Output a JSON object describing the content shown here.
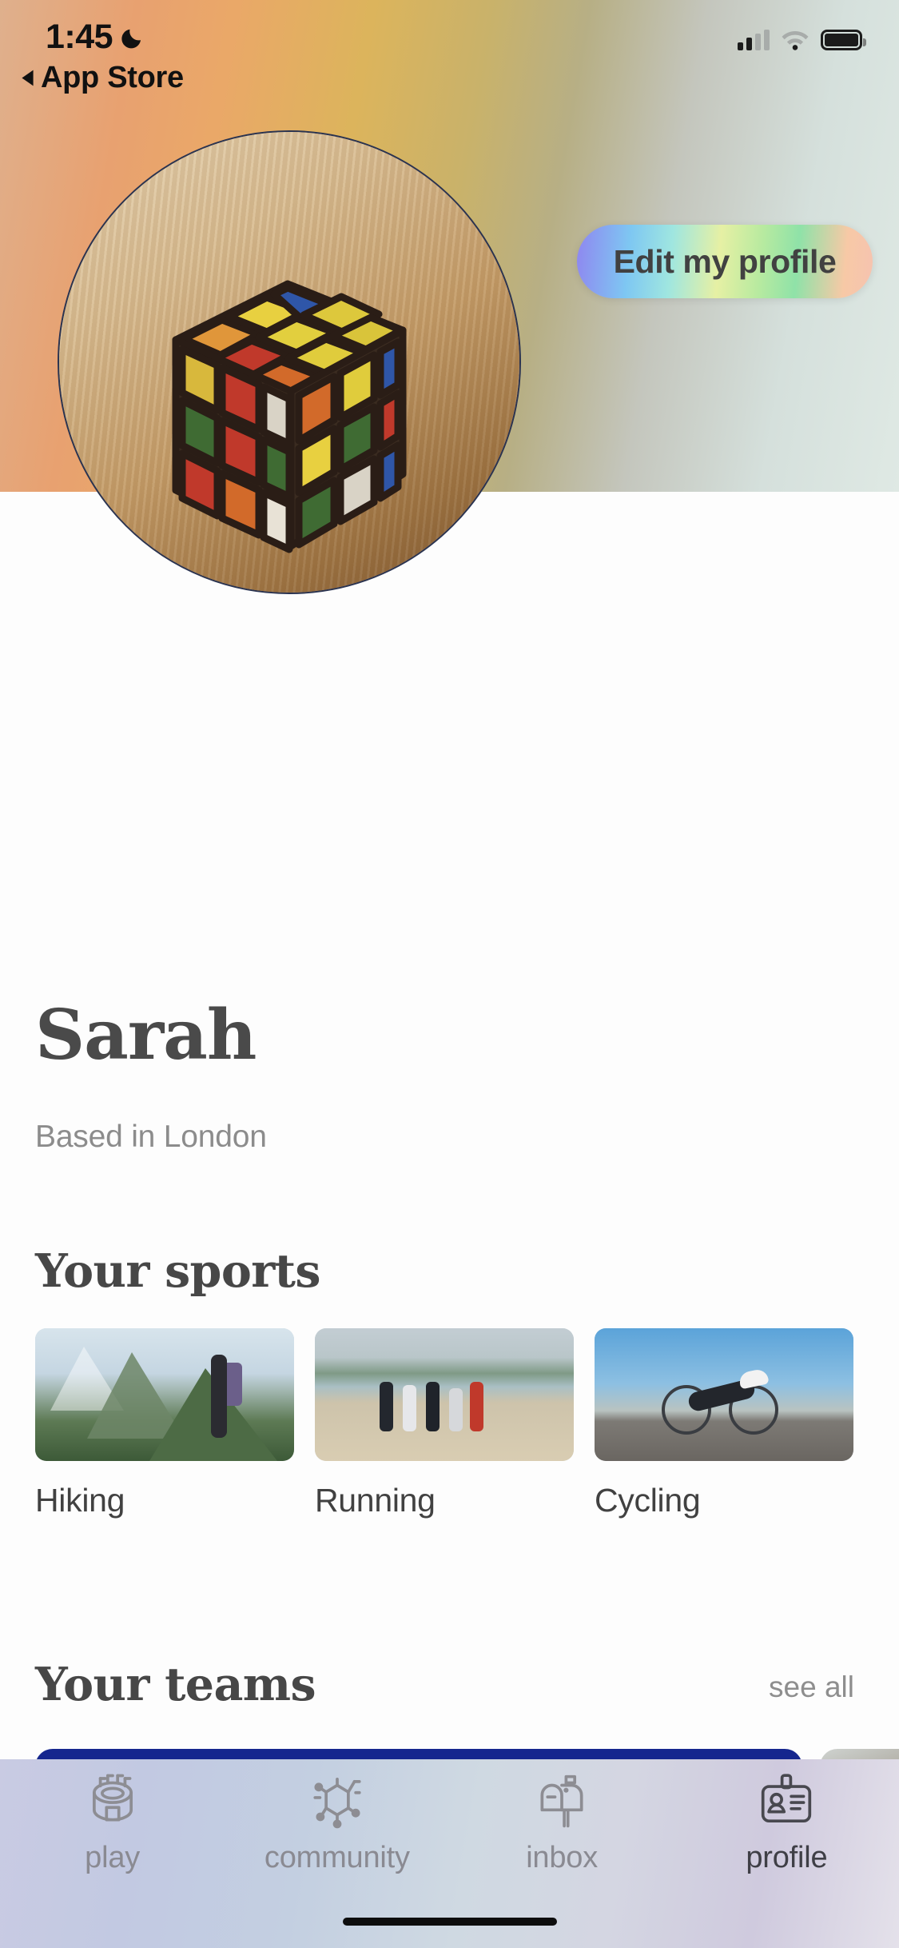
{
  "status_bar": {
    "time": "1:45",
    "dnd_icon": "crescent-moon-icon",
    "back_label": "App Store",
    "back_icon": "triangle-left-icon",
    "signal_icon": "cellular-bars-icon",
    "wifi_icon": "wifi-icon",
    "battery_icon": "battery-full-icon"
  },
  "header": {
    "edit_button_label": "Edit my profile",
    "avatar_alt": "rubiks-cube-photo"
  },
  "profile": {
    "name": "Sarah",
    "location": "Based in London"
  },
  "sports_section": {
    "title": "Your sports",
    "items": [
      {
        "label": "Hiking",
        "image": "hiker-on-mountain-photo"
      },
      {
        "label": "Running",
        "image": "beach-runners-photo"
      },
      {
        "label": "Cycling",
        "image": "cyclist-in-desert-photo"
      }
    ]
  },
  "teams_section": {
    "title": "Your teams",
    "see_all_label": "see all",
    "cards": [
      {
        "color": "#15268e"
      },
      {
        "color": "#8a7f6f"
      }
    ]
  },
  "tab_bar": {
    "items": [
      {
        "label": "play",
        "icon": "stadium-icon",
        "active": false
      },
      {
        "label": "community",
        "icon": "network-icon",
        "active": false
      },
      {
        "label": "inbox",
        "icon": "mailbox-icon",
        "active": false
      },
      {
        "label": "profile",
        "icon": "id-card-icon",
        "active": true
      }
    ]
  },
  "colors": {
    "header_gradient_start": "#dfb08d",
    "header_gradient_mid": "#dcb45c",
    "header_gradient_end": "#dfe9e4",
    "team_card_navy": "#15268e",
    "name_text": "#4a4a4a",
    "muted_text": "#8c8c8c",
    "tab_active": "#3f3f46",
    "tab_inactive": "#8a8a92"
  }
}
